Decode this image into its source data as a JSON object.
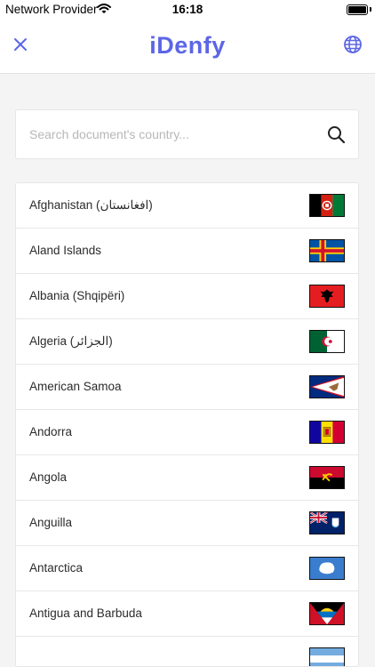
{
  "status_bar": {
    "carrier": "Network Provider",
    "time": "16:18"
  },
  "header": {
    "logo": "iDenfy",
    "brand_color": "#5c66e6"
  },
  "search": {
    "placeholder": "Search document's country..."
  },
  "countries": [
    {
      "name": "Afghanistan (افغانستان)",
      "flag": "flag-afghanistan"
    },
    {
      "name": "Aland Islands",
      "flag": "flag-aland-islands"
    },
    {
      "name": "Albania (Shqipëri)",
      "flag": "flag-albania"
    },
    {
      "name": "Algeria (الجزائر)",
      "flag": "flag-algeria"
    },
    {
      "name": "American Samoa",
      "flag": "flag-american-samoa"
    },
    {
      "name": "Andorra",
      "flag": "flag-andorra"
    },
    {
      "name": "Angola",
      "flag": "flag-angola"
    },
    {
      "name": "Anguilla",
      "flag": "flag-anguilla"
    },
    {
      "name": "Antarctica",
      "flag": "flag-antarctica"
    },
    {
      "name": "Antigua and Barbuda",
      "flag": "flag-antigua-and-barbuda"
    },
    {
      "name": "",
      "flag": "flag-argentina"
    }
  ]
}
